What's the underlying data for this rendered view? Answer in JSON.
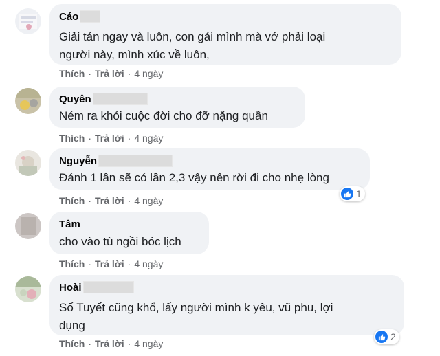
{
  "comments": [
    {
      "name": "Cáo",
      "text_lines": [
        "Giải tán ngay và luôn, con gái mình mà vớ phải loại",
        "người này, mình xúc về luôn,"
      ],
      "like": "Thích",
      "reply": "Trả lời",
      "time": "4 ngày"
    },
    {
      "name": "Quyên",
      "text_lines": [
        "Ném ra khỏi cuộc đời cho đỡ nặng quần"
      ],
      "like": "Thích",
      "reply": "Trả lời",
      "time": "4 ngày"
    },
    {
      "name": "Nguyễn",
      "text_lines": [
        "Đánh 1 lần sẽ có lần 2,3 vậy nên rời đi cho nhẹ lòng"
      ],
      "like": "Thích",
      "reply": "Trả lời",
      "time": "4 ngày",
      "reaction_count": "1"
    },
    {
      "name": "Tâm",
      "text_lines": [
        "cho vào tù ngồi bóc lịch"
      ],
      "like": "Thích",
      "reply": "Trả lời",
      "time": "4 ngày"
    },
    {
      "name": "Hoài",
      "text_lines": [
        "Số Tuyết cũng khổ, lấy người mình k yêu, vũ phu, lợi",
        "dụng"
      ],
      "like": "Thích",
      "reply": "Trả lời",
      "time": "4 ngày",
      "reaction_count": "2"
    }
  ],
  "colors": {
    "bubble": "#f0f2f5",
    "like_blue": "#1877f2",
    "meta": "#65676b"
  },
  "icons": {
    "reaction": "like-icon"
  }
}
